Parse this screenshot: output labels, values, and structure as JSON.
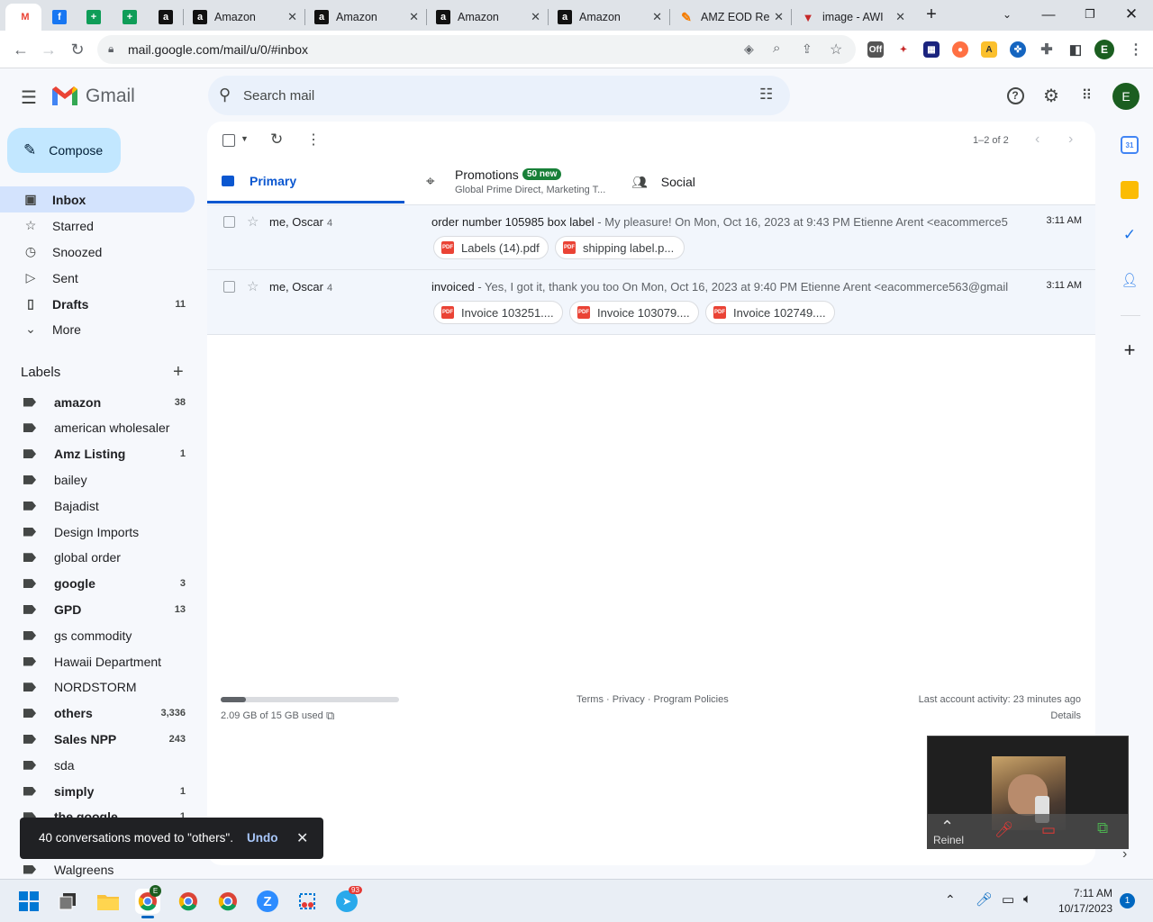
{
  "browser": {
    "tabs": [
      {
        "label": "",
        "favicon": "gmail-icon"
      },
      {
        "label": "",
        "favicon": "facebook-icon"
      },
      {
        "label": "",
        "favicon": "sheets-icon"
      },
      {
        "label": "",
        "favicon": "sheets-icon"
      },
      {
        "label": "",
        "favicon": "amazon-icon"
      },
      {
        "label": "Amazon",
        "favicon": "amazon-icon"
      },
      {
        "label": "Amazon",
        "favicon": "amazon-icon"
      },
      {
        "label": "Amazon",
        "favicon": "amazon-icon"
      },
      {
        "label": "Amazon",
        "favicon": "amazon-icon"
      },
      {
        "label": "AMZ EOD Re",
        "favicon": "amz-eod-icon"
      },
      {
        "label": "image - AWI",
        "favicon": "image-awi-icon"
      }
    ],
    "url": "mail.google.com/mail/u/0/#inbox",
    "profile_initial": "E"
  },
  "gmail": {
    "logo_text": "Gmail",
    "search_placeholder": "Search mail",
    "account_initial": "E",
    "compose_label": "Compose",
    "nav": [
      {
        "label": "Inbox",
        "count": "",
        "icon": "inbox-icon"
      },
      {
        "label": "Starred",
        "count": "",
        "icon": "star-icon"
      },
      {
        "label": "Snoozed",
        "count": "",
        "icon": "clock-icon"
      },
      {
        "label": "Sent",
        "count": "",
        "icon": "send-icon"
      },
      {
        "label": "Drafts",
        "count": "11",
        "icon": "draft-icon"
      },
      {
        "label": "More",
        "count": "",
        "icon": "chevron-down-icon"
      }
    ],
    "labels_heading": "Labels",
    "labels": [
      {
        "name": "amazon",
        "count": "38"
      },
      {
        "name": "american wholesaler",
        "count": ""
      },
      {
        "name": "Amz Listing",
        "count": "1"
      },
      {
        "name": "bailey",
        "count": ""
      },
      {
        "name": "Bajadist",
        "count": ""
      },
      {
        "name": "Design Imports",
        "count": ""
      },
      {
        "name": "global order",
        "count": ""
      },
      {
        "name": "google",
        "count": "3"
      },
      {
        "name": "GPD",
        "count": "13"
      },
      {
        "name": "gs commodity",
        "count": ""
      },
      {
        "name": "Hawaii Department",
        "count": ""
      },
      {
        "name": "NORDSTORM",
        "count": ""
      },
      {
        "name": "others",
        "count": "3,336"
      },
      {
        "name": "Sales NPP",
        "count": "243"
      },
      {
        "name": "sda",
        "count": ""
      },
      {
        "name": "simply",
        "count": "1"
      },
      {
        "name": "the google",
        "count": "1"
      },
      {
        "name": "Walgreens",
        "count": ""
      }
    ],
    "pagination": "1–2 of 2",
    "tabs": {
      "primary": "Primary",
      "promotions": "Promotions",
      "promotions_badge": "50 new",
      "promotions_sub": "Global Prime Direct, Marketing T...",
      "social": "Social"
    },
    "emails": [
      {
        "sender": "me, Oscar",
        "count": "4",
        "subject": "order number 105985 box label",
        "snippet": " - My pleasure! On Mon, Oct 16, 2023 at 9:43 PM Etienne Arent <eacommerce5...",
        "time": "3:11 AM",
        "attachments": [
          "Labels (14).pdf",
          "shipping label.p..."
        ]
      },
      {
        "sender": "me, Oscar",
        "count": "4",
        "subject": "invoiced",
        "snippet": " - Yes, I got it, thank you too On Mon, Oct 16, 2023 at 9:40 PM Etienne Arent <eacommerce563@gmail....",
        "time": "3:11 AM",
        "attachments": [
          "Invoice 103251....",
          "Invoice 103079....",
          "Invoice 102749...."
        ]
      }
    ],
    "footer": {
      "storage": "2.09 GB of 15 GB used",
      "storage_fraction": 0.14,
      "links": "Terms · Privacy · Program Policies",
      "activity": "Last account activity: 23 minutes ago",
      "details": "Details"
    },
    "snackbar": {
      "message": "40 conversations moved to \"others\".",
      "undo": "Undo"
    }
  },
  "video": {
    "participant": "Reinel"
  },
  "taskbar": {
    "time": "7:11 AM",
    "date": "10/17/2023",
    "notifications": "1",
    "telegram_badge": "93"
  }
}
